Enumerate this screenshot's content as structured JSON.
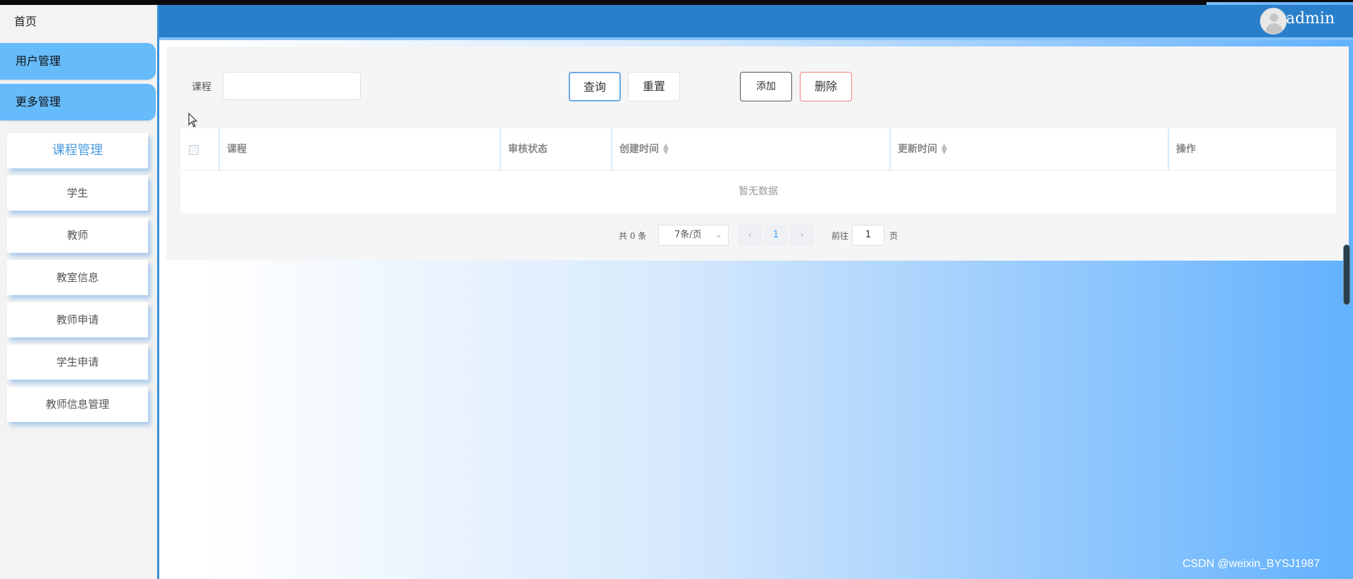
{
  "sidebar": {
    "home_label": "首页",
    "menus": [
      {
        "label": "用户管理"
      },
      {
        "label": "更多管理"
      }
    ],
    "submenu": [
      {
        "label": "课程管理",
        "active": true
      },
      {
        "label": "学生"
      },
      {
        "label": "教师"
      },
      {
        "label": "教室信息"
      },
      {
        "label": "教师申请"
      },
      {
        "label": "学生申请"
      },
      {
        "label": "教师信息管理"
      }
    ]
  },
  "header": {
    "username": "admin",
    "avatar_icon": "user-avatar-icon"
  },
  "search": {
    "label": "课程",
    "value": "",
    "placeholder": ""
  },
  "buttons": {
    "query": "查询",
    "reset": "重置",
    "add": "添加",
    "delete": "删除"
  },
  "table": {
    "columns": [
      "课程",
      "审核状态",
      "创建时间",
      "更新时间",
      "操作"
    ],
    "rows": [],
    "empty_text": "暂无数据"
  },
  "pagination": {
    "total_text": "共 0 条",
    "page_size": "7条/页",
    "current_page": "1",
    "goto_label": "前往",
    "goto_value": "1",
    "page_unit": "页"
  },
  "watermark": "CSDN @weixin_BYSJ1987",
  "colors": {
    "header": "#2a7fca",
    "menu_item": "#66bbfb",
    "active_submenu_text": "#4d9de0",
    "delete_border": "#f08080"
  }
}
